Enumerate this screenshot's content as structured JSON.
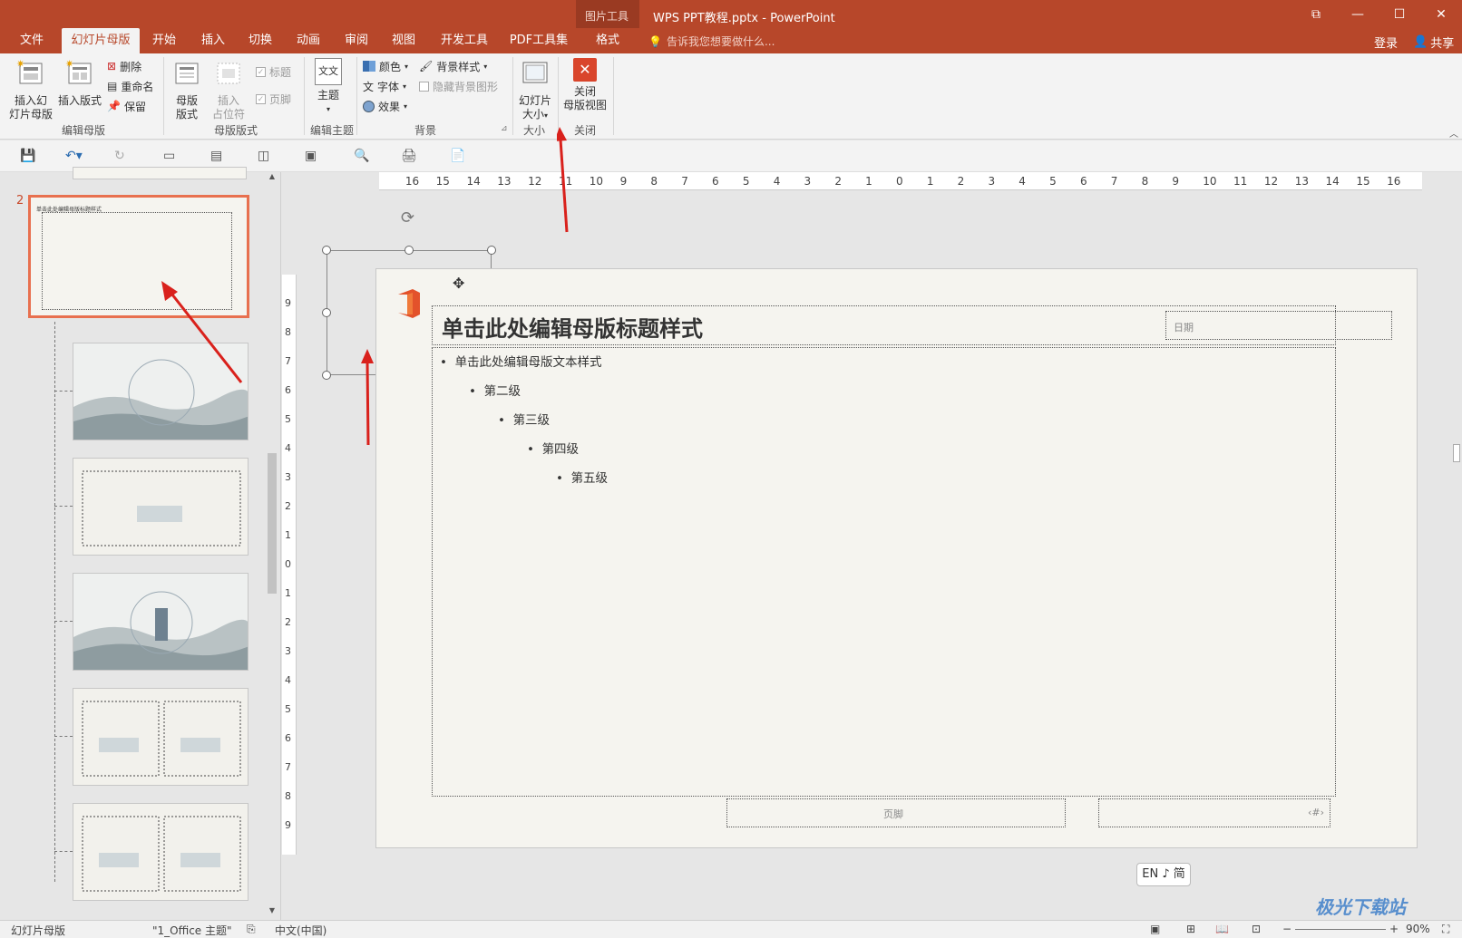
{
  "window": {
    "context_tools_label": "图片工具",
    "title": "WPS PPT教程.pptx - PowerPoint",
    "controls": [
      "⧉",
      "—",
      "☐",
      "✕"
    ]
  },
  "tabs": [
    {
      "label": "文件"
    },
    {
      "label": "幻灯片母版"
    },
    {
      "label": "开始"
    },
    {
      "label": "插入"
    },
    {
      "label": "切换"
    },
    {
      "label": "动画"
    },
    {
      "label": "审阅"
    },
    {
      "label": "视图"
    },
    {
      "label": "开发工具"
    },
    {
      "label": "PDF工具集"
    },
    {
      "label": "格式"
    }
  ],
  "active_tab_index": 1,
  "tell_me": "告诉我您想要做什么...",
  "account": {
    "login": "登录",
    "share": "共享"
  },
  "ribbon": {
    "insert_slide_master": [
      "插入幻",
      "灯片母版"
    ],
    "insert_layout": "插入版式",
    "delete": "删除",
    "rename": "重命名",
    "preserve": "保留",
    "group_edit_master": "编辑母版",
    "master_layout": [
      "母版",
      "版式"
    ],
    "insert_placeholder": [
      "插入",
      "占位符"
    ],
    "title_checkbox": "标题",
    "footer_checkbox": "页脚",
    "group_master_layout": "母版版式",
    "theme": "主题",
    "theme_icon_text": "文文",
    "group_edit_theme": "编辑主题",
    "colors": "颜色",
    "fonts": "字体",
    "effects": "效果",
    "background_styles": "背景样式",
    "hide_background": "隐藏背景图形",
    "group_background": "背景",
    "slide_size": [
      "幻灯片",
      "大小"
    ],
    "group_size": "大小",
    "close_master": [
      "关闭",
      "母版视图"
    ],
    "group_close": "关闭"
  },
  "thumbnails": {
    "selected_number": "2",
    "selected_title": "单击此处编辑母版标题样式"
  },
  "slide": {
    "title": "单击此处编辑母版标题样式",
    "date_label": "日期",
    "footer_label": "页脚",
    "number_label": "‹#›",
    "levels": [
      "单击此处编辑母版文本样式",
      "第二级",
      "第三级",
      "第四级",
      "第五级"
    ],
    "bullet": "•"
  },
  "ruler": {
    "h_ticks": [
      "16",
      "15",
      "14",
      "13",
      "12",
      "11",
      "10",
      "9",
      "8",
      "7",
      "6",
      "5",
      "4",
      "3",
      "2",
      "1",
      "0",
      "1",
      "2",
      "3",
      "4",
      "5",
      "6",
      "7",
      "8",
      "9",
      "10",
      "11",
      "12",
      "13",
      "14",
      "15",
      "16"
    ],
    "v_ticks": [
      "9",
      "8",
      "7",
      "6",
      "5",
      "4",
      "3",
      "2",
      "1",
      "0",
      "1",
      "2",
      "3",
      "4",
      "5",
      "6",
      "7",
      "8",
      "9"
    ]
  },
  "ime": "EN ♪ 简",
  "status": {
    "view": "幻灯片母版",
    "theme": "\"1_Office 主题\"",
    "language": "中文(中国)",
    "zoom": "90%"
  },
  "watermark": "极光下载站",
  "colors": {
    "accent": "#b7472a",
    "selection": "#e8704f",
    "arrow": "#d9211c"
  }
}
